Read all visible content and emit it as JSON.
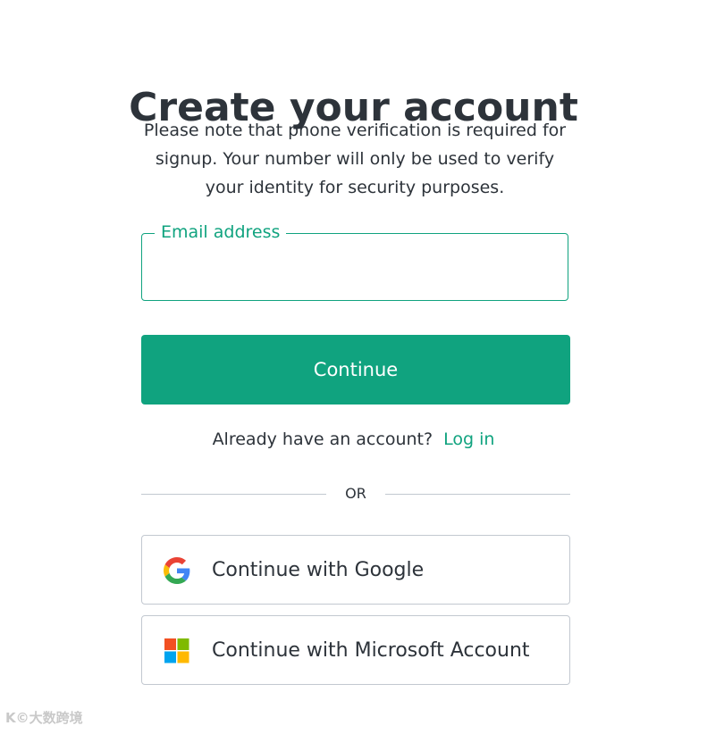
{
  "page": {
    "title": "Create your account",
    "subtitle": "Please note that phone verification is required for signup. Your number will only be used to verify your identity for security purposes."
  },
  "email": {
    "label": "Email address",
    "value": "",
    "placeholder": ""
  },
  "continue_button": {
    "label": "Continue"
  },
  "login": {
    "prompt": "Already have an account?",
    "link_label": "Log in"
  },
  "divider": {
    "label": "OR"
  },
  "social": {
    "google": {
      "label": "Continue with Google",
      "icon": "google-icon"
    },
    "microsoft": {
      "label": "Continue with Microsoft Account",
      "icon": "microsoft-icon"
    }
  },
  "colors": {
    "accent": "#10a37f",
    "text": "#2d333a",
    "border": "#c2c8d0"
  },
  "watermark": {
    "text": "K©大数跨境"
  }
}
